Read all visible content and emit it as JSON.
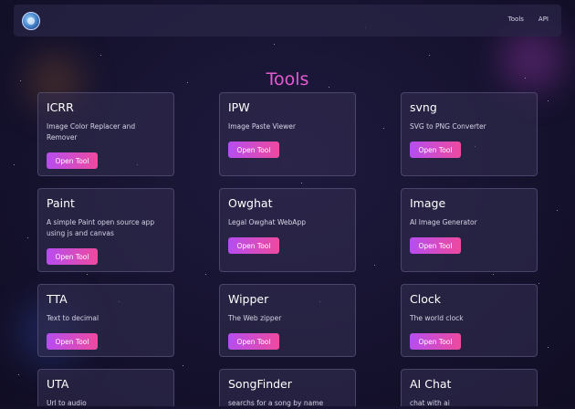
{
  "nav": {
    "logo_icon": "globe-logo-icon",
    "links": [
      "Tools",
      "API"
    ]
  },
  "page": {
    "title": "Tools"
  },
  "button_label": "Open Tool",
  "colors": {
    "title": "#e45bd1",
    "button_gradient_start": "#b64df0",
    "button_gradient_end": "#ee4a9e",
    "background": "#15122e"
  },
  "tools": [
    {
      "title": "ICRR",
      "desc": "Image Color Replacer and Remover"
    },
    {
      "title": "IPW",
      "desc": "Image Paste Viewer"
    },
    {
      "title": "svng",
      "desc": "SVG to PNG Converter"
    },
    {
      "title": "Paint",
      "desc": "A simple Paint open source app using js and canvas"
    },
    {
      "title": "Owghat",
      "desc": "Legal Owghat WebApp"
    },
    {
      "title": "Image",
      "desc": "AI Image Generator"
    },
    {
      "title": "TTA",
      "desc": "Text to decimal"
    },
    {
      "title": "Wipper",
      "desc": "The Web zipper"
    },
    {
      "title": "Clock",
      "desc": "The world clock"
    },
    {
      "title": "UTA",
      "desc": "Url to audio"
    },
    {
      "title": "SongFinder",
      "desc": "searchs for a song by name"
    },
    {
      "title": "AI Chat",
      "desc": "chat with ai"
    }
  ]
}
